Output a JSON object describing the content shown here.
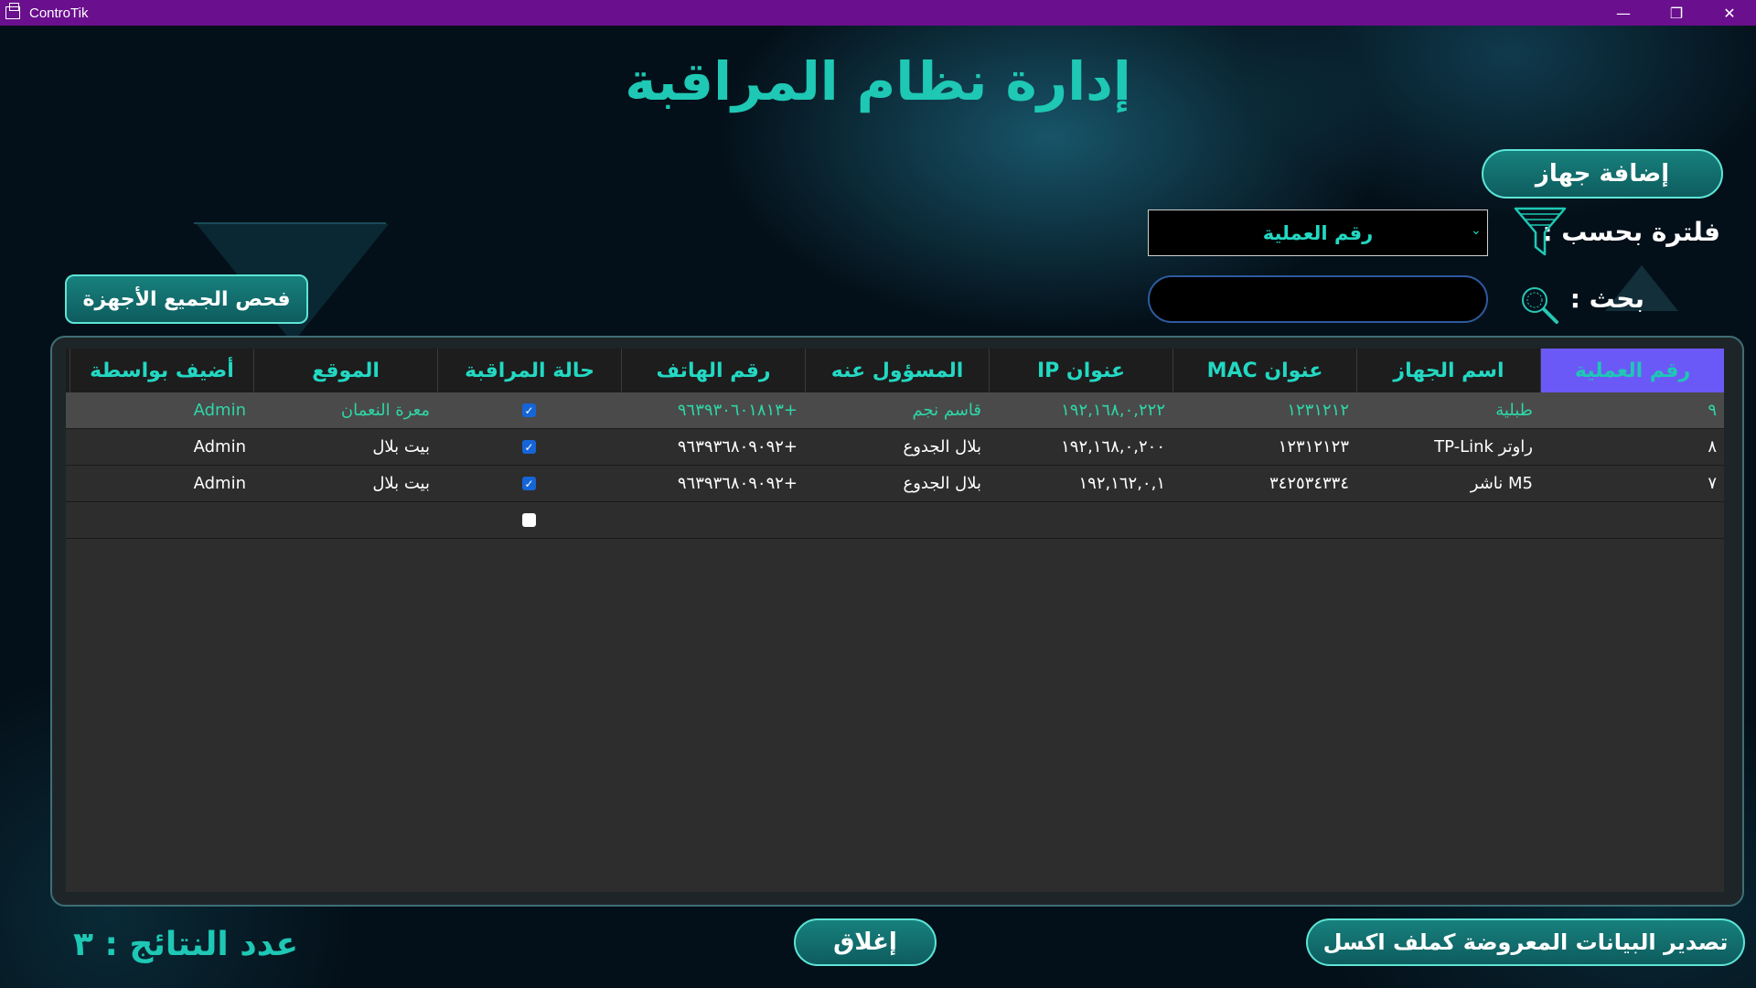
{
  "window": {
    "app_name": "ControTik",
    "minimize": "—",
    "restore": "❐",
    "close": "✕"
  },
  "page": {
    "title": "إدارة نظام المراقبة"
  },
  "toolbar": {
    "add_device": "إضافة جهاز",
    "filter_label": "فلترة بحسب :",
    "filter_selected": "رقم العملية",
    "search_label": "بحث :",
    "search_value": "",
    "scan_all": "فحص الجميع الأجهزة"
  },
  "table": {
    "columns": [
      "رقم العملية",
      "اسم الجهاز",
      "عنوان MAC",
      "عنوان IP",
      "المسؤول عنه",
      "رقم الهاتف",
      "حالة المراقبة",
      "الموقع",
      "أضيف بواسطة"
    ],
    "rows": [
      {
        "id": "٩",
        "name": "طبلية",
        "mac": "١٢٣١٢١٢",
        "ip": "١٩٢,١٦٨,٠,٢٢٢",
        "owner": "قاسم نجم",
        "phone": "+٩٦٣٩٣٠٦٠١٨١٣",
        "monitored": true,
        "location": "معرة النعمان",
        "added_by": "Admin"
      },
      {
        "id": "٨",
        "name": "راوتر TP-Link",
        "mac": "١٢٣١٢١٢٣",
        "ip": "١٩٢,١٦٨,٠,٢٠٠",
        "owner": "بلال الجدوع",
        "phone": "+٩٦٣٩٣٦٨٠٩٠٩٢",
        "monitored": true,
        "location": "بيت بلال",
        "added_by": "Admin"
      },
      {
        "id": "٧",
        "name": "M5 ناشر",
        "mac": "٣٤٢٥٣٤٣٣٤",
        "ip": "١٩٢,١٦٢,٠,١",
        "owner": "بلال الجدوع",
        "phone": "+٩٦٣٩٣٦٨٠٩٠٩٢",
        "monitored": true,
        "location": "بيت بلال",
        "added_by": "Admin"
      }
    ],
    "new_row_monitored": false
  },
  "footer": {
    "result_count": "عدد النتائج : ٣",
    "close": "إغلاق",
    "export": "تصدير البيانات المعروضة كملف اكسل"
  },
  "colors": {
    "titlebar": "#6a0f8e",
    "accent": "#1ec8b4",
    "active_header": "#6b59f7",
    "button": "#17817d"
  }
}
